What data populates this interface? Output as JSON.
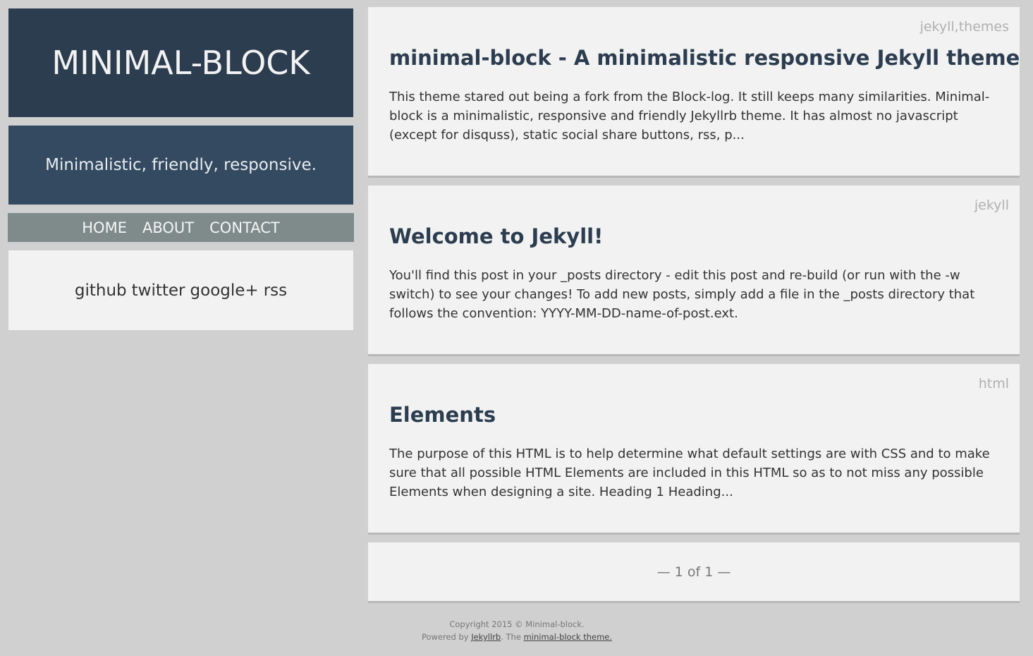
{
  "sidebar": {
    "site_title": "MINIMAL-BLOCK",
    "tagline": "Minimalistic, friendly, responsive.",
    "nav": [
      "HOME",
      "ABOUT",
      "CONTACT"
    ],
    "social": [
      "github",
      "twitter",
      "google+",
      "rss"
    ]
  },
  "posts": [
    {
      "tags": "jekyll,themes",
      "title": "minimal-block - A minimalistic responsive Jekyll theme",
      "excerpt": "This theme stared out being a fork from the Block-log. It still keeps many similarities. Minimal-block is a minimalistic, responsive and friendly Jekyllrb theme. It has almost no javascript (except for disquss), static social share buttons, rss, p..."
    },
    {
      "tags": "jekyll",
      "title": "Welcome to Jekyll!",
      "excerpt": "You'll find this post in your _posts directory - edit this post and re-build (or run with the -w switch) to see your changes! To add new posts, simply add a file in the _posts directory that follows the convention: YYYY-MM-DD-name-of-post.ext."
    },
    {
      "tags": "html",
      "title": "Elements",
      "excerpt": "The purpose of this HTML is to help determine what default settings are with CSS and to make sure that all possible HTML Elements are included in this HTML so as to not miss any possible Elements when designing a site. Heading 1 Heading..."
    }
  ],
  "pagination": "— 1 of 1 —",
  "footer": {
    "copyright": "Copyright 2015 © Minimal-block.",
    "powered_prefix": "Powered by ",
    "jekyll_link": "Jekyllrb",
    "middle": ". The ",
    "theme_link": "minimal-block theme."
  },
  "colors": {
    "background": "#d0d0d0",
    "title_box": "#2c3d50",
    "tagline_box": "#344a61",
    "nav_box": "#7f8b8b",
    "card": "#f2f2f2",
    "heading": "#2c3d50"
  }
}
